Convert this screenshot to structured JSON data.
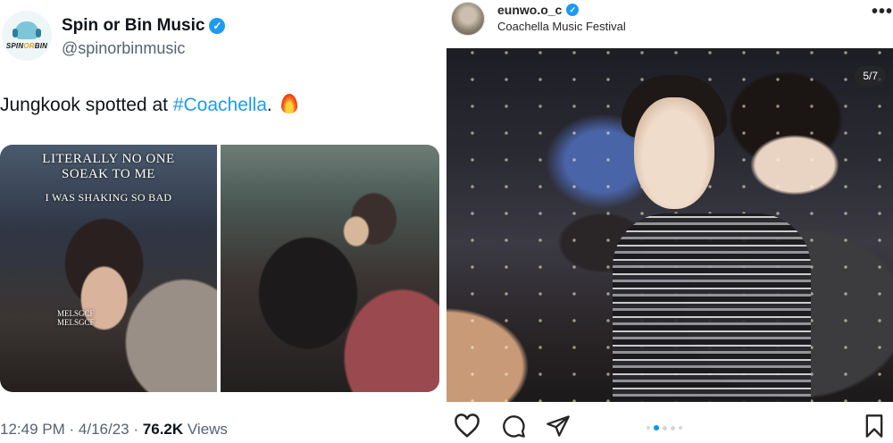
{
  "tweet": {
    "avatar_logo_text_a": "SPIN",
    "avatar_logo_text_b": "OR",
    "avatar_logo_text_c": "BIN",
    "name": "Spin or Bin Music",
    "handle": "@spinorbinmusic",
    "text_before": "Jungkook spotted at ",
    "hashtag": "#Coachella",
    "text_after": ".",
    "media_caption_line1": "LITERALLY NO ONE",
    "media_caption_line2": "SOEAK TO ME",
    "media_caption_line3": "I WAS SHAKING SO BAD",
    "watermark_line1": "MELSGCF",
    "watermark_line2": "MELSGCF",
    "time": "12:49 PM",
    "separator": "·",
    "date": "4/16/23",
    "views_count": "76.2K",
    "views_label": "Views",
    "accent_color": "#1d9bf0"
  },
  "instagram": {
    "username": "eunwo.o_c",
    "location": "Coachella Music Festival",
    "more_icon": "more-icon",
    "counter": "5/7",
    "carousel_total": 5,
    "carousel_active_index": 1,
    "actions": [
      "heart-icon",
      "comment-icon",
      "share-icon",
      "bookmark-icon"
    ]
  }
}
